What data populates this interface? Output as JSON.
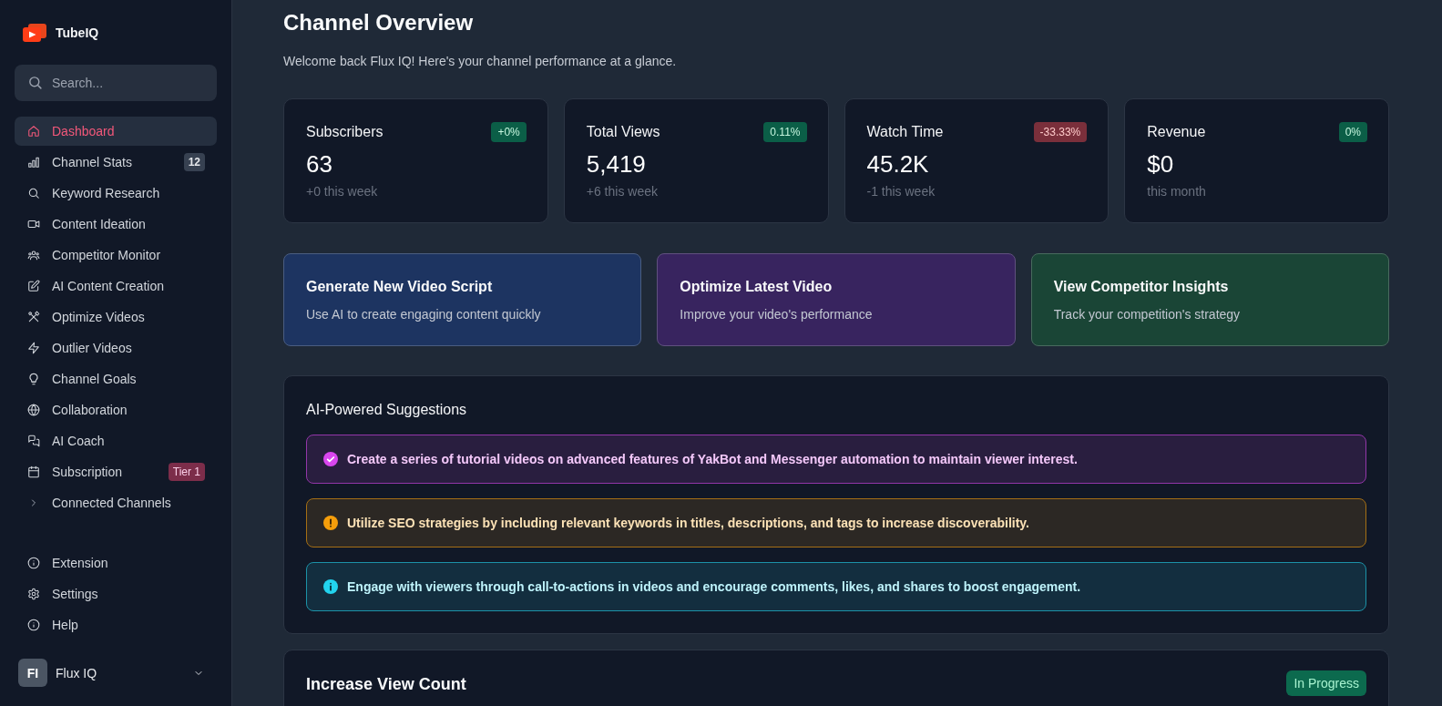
{
  "app": {
    "name": "TubeIQ"
  },
  "sidebar": {
    "search": {
      "placeholder": "Search..."
    },
    "nav": [
      {
        "label": "Dashboard",
        "kind": "link",
        "selected": true
      },
      {
        "label": "Channel Stats",
        "kind": "link",
        "selected": false,
        "badge": {
          "text": "12",
          "kind": "count"
        }
      },
      {
        "label": "Keyword Research",
        "kind": "link",
        "selected": false
      },
      {
        "label": "Content Ideation",
        "kind": "link",
        "selected": false
      },
      {
        "label": "Competitor Monitor",
        "kind": "link",
        "selected": false
      },
      {
        "label": "AI Content Creation",
        "kind": "link",
        "selected": false
      },
      {
        "label": "Optimize Videos",
        "kind": "link",
        "selected": false
      },
      {
        "label": "Outlier Videos",
        "kind": "link",
        "selected": false
      },
      {
        "label": "Channel Goals",
        "kind": "link",
        "selected": false
      },
      {
        "label": "Collaboration",
        "kind": "link",
        "selected": false
      },
      {
        "label": "AI Coach",
        "kind": "link",
        "selected": false
      },
      {
        "label": "Subscription",
        "kind": "link",
        "selected": false,
        "badge": {
          "text": "Tier 1",
          "kind": "tier"
        }
      },
      {
        "label": "Connected Channels",
        "kind": "group",
        "selected": false,
        "expanded": false
      }
    ],
    "footer_nav": [
      {
        "label": "Extension"
      },
      {
        "label": "Settings"
      },
      {
        "label": "Help"
      }
    ],
    "user": {
      "initials": "FI",
      "name": "Flux IQ"
    }
  },
  "page": {
    "title": "Channel Overview",
    "subtitle": "Welcome back Flux IQ! Here's your channel performance at a glance."
  },
  "stats": [
    {
      "label": "Subscribers",
      "change": "+0%",
      "kind": "positive",
      "value": "63",
      "note": "+0 this week"
    },
    {
      "label": "Total Views",
      "change": "0.11%",
      "kind": "positive",
      "value": "5,419",
      "note": "+6 this week"
    },
    {
      "label": "Watch Time",
      "change": "-33.33%",
      "kind": "negative",
      "value": "45.2K",
      "note": "-1 this week"
    },
    {
      "label": "Revenue",
      "change": "0%",
      "kind": "positive",
      "value": "$0",
      "note": "this month"
    }
  ],
  "actions": [
    {
      "title": "Generate New Video Script",
      "description": "Use AI to create engaging content quickly",
      "color": "#1d3461"
    },
    {
      "title": "Optimize Latest Video",
      "description": "Improve your video's performance",
      "color": "#38245f"
    },
    {
      "title": "View Competitor Insights",
      "description": "Track your competition's strategy",
      "color": "#1a4536"
    }
  ],
  "suggestions": {
    "title": "AI-Powered Suggestions",
    "items": [
      {
        "kind": "success",
        "color": "#d946ef",
        "text": "Create a series of tutorial videos on advanced features of YakBot and Messenger automation to maintain viewer interest."
      },
      {
        "kind": "warning",
        "color": "#f59e0b",
        "text": "Utilize SEO strategies by including relevant keywords in titles, descriptions, and tags to increase discoverability."
      },
      {
        "kind": "info",
        "color": "#22d3ee",
        "text": "Engage with viewers through call-to-actions in videos and encourage comments, likes, and shares to boost engagement."
      }
    ]
  },
  "goal": {
    "title": "Increase View Count",
    "status": "In Progress"
  }
}
